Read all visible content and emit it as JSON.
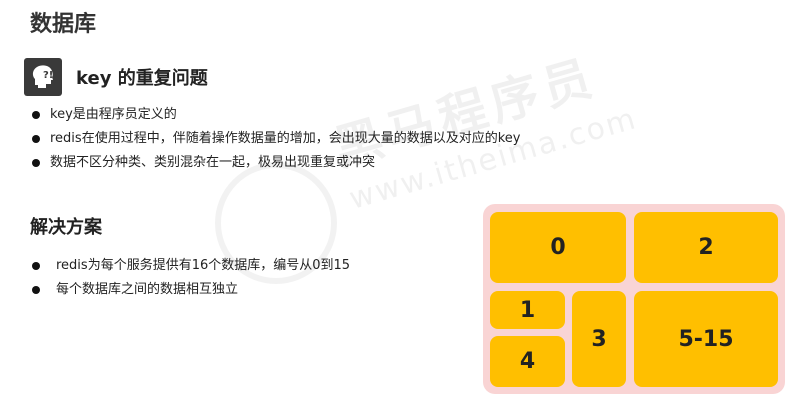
{
  "page": {
    "title": "数据库"
  },
  "section": {
    "icon": "thinking-head-icon",
    "title": "key 的重复问题",
    "bullets": [
      "key是由程序员定义的",
      "redis在使用过程中，伴随着操作数据量的增加，会出现大量的数据以及对应的key",
      "数据不区分种类、类别混杂在一起，极易出现重复或冲突"
    ]
  },
  "solution": {
    "title": "解决方案",
    "bullets": [
      "redis为每个服务提供有16个数据库，编号从0到15",
      "每个数据库之间的数据相互独立"
    ]
  },
  "watermark": {
    "brand": "黑马程序员",
    "url": "www.itheima.com"
  },
  "diagram": {
    "cells": [
      "0",
      "2",
      "1",
      "4",
      "3",
      "5-15"
    ],
    "colors": {
      "background": "#f9d4d4",
      "cell": "#ffbf00"
    }
  }
}
